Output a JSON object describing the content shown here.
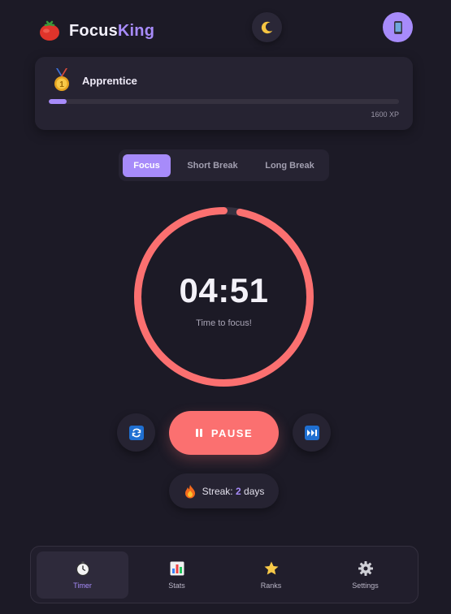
{
  "app": {
    "name_part1": "Focus",
    "name_part2": "King",
    "logo_icon": "tomato-icon",
    "theme_toggle_icon": "moon-icon",
    "device_icon": "mobile-phone-icon"
  },
  "rank": {
    "name": "Apprentice",
    "icon": "medal-icon",
    "xp_label": "1600 XP",
    "progress_fraction": 0.05
  },
  "modes": {
    "tabs": [
      {
        "label": "Focus",
        "active": true
      },
      {
        "label": "Short Break",
        "active": false
      },
      {
        "label": "Long Break",
        "active": false
      }
    ]
  },
  "timer": {
    "time": "04:51",
    "caption": "Time to focus!",
    "progress_fraction": 0.03
  },
  "controls": {
    "reset_icon": "reset-icon",
    "pause_label": "PAUSE",
    "pause_icon": "pause-icon",
    "skip_icon": "skip-forward-icon"
  },
  "streak": {
    "icon": "fire-icon",
    "prefix": "Streak:",
    "count": "2",
    "unit": "days"
  },
  "nav": {
    "items": [
      {
        "label": "Timer",
        "icon": "stopwatch-icon",
        "active": true
      },
      {
        "label": "Stats",
        "icon": "bar-chart-icon",
        "active": false
      },
      {
        "label": "Ranks",
        "icon": "star-icon",
        "active": false
      },
      {
        "label": "Settings",
        "icon": "gear-icon",
        "active": false
      }
    ]
  },
  "colors": {
    "accent": "#a78bfa",
    "timer_ring": "#fb7070",
    "background": "#1c1a26",
    "card": "#262332"
  }
}
